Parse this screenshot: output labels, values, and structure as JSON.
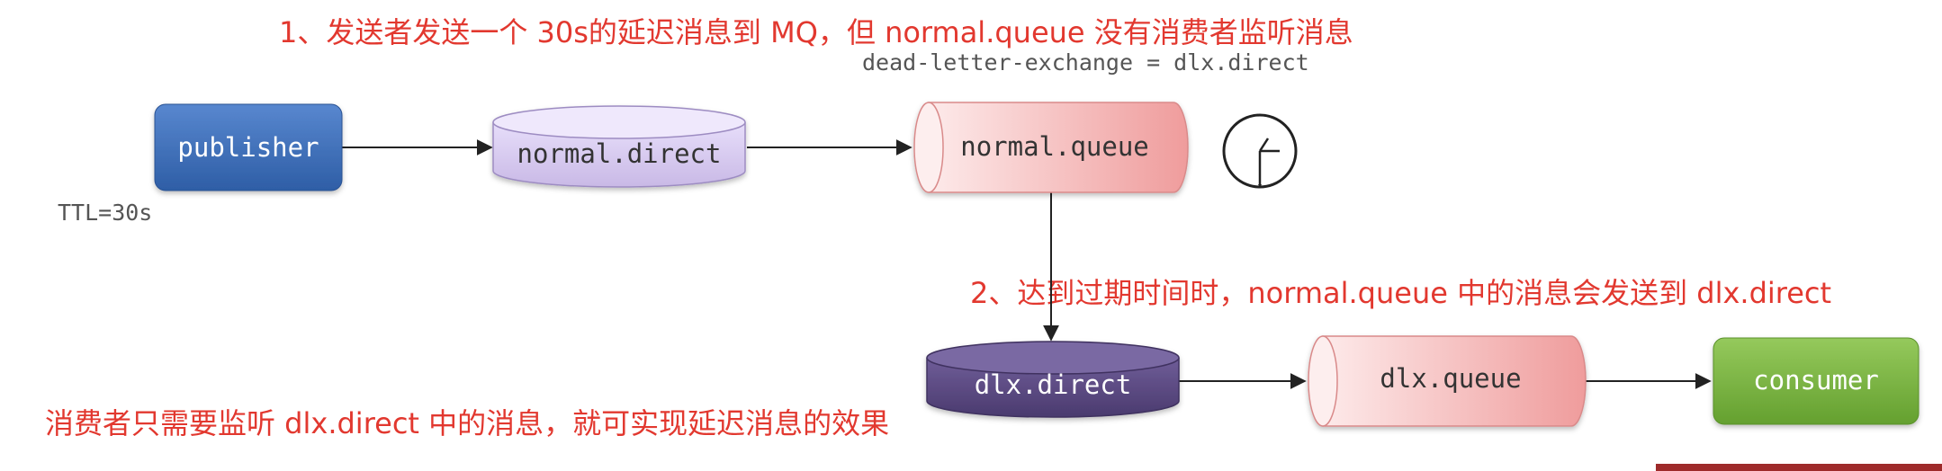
{
  "annotations": {
    "step1": "1、发送者发送一个 30s的延迟消息到 MQ，但 normal.queue 没有消费者监听消息",
    "step2": "2、达到过期时间时，normal.queue 中的消息会发送到 dlx.direct",
    "summary": "消费者只需要监听 dlx.direct 中的消息，就可实现延迟消息的效果"
  },
  "labels": {
    "dead_letter_config": "dead-letter-exchange = dlx.direct",
    "ttl": "TTL=30s"
  },
  "nodes": {
    "publisher": "publisher",
    "normal_exchange": "normal.direct",
    "normal_queue": "normal.queue",
    "dlx_exchange": "dlx.direct",
    "dlx_queue": "dlx.queue",
    "consumer": "consumer"
  },
  "icons": {
    "timer": "clock-icon"
  },
  "colors": {
    "annotation_red": "#e2382f",
    "publisher_blue": "#3f6fb8",
    "exchange_lavender": "#d9cdef",
    "queue_pink": "#f6b4b4",
    "dlx_purple": "#5b4a82",
    "consumer_green": "#7db643"
  }
}
